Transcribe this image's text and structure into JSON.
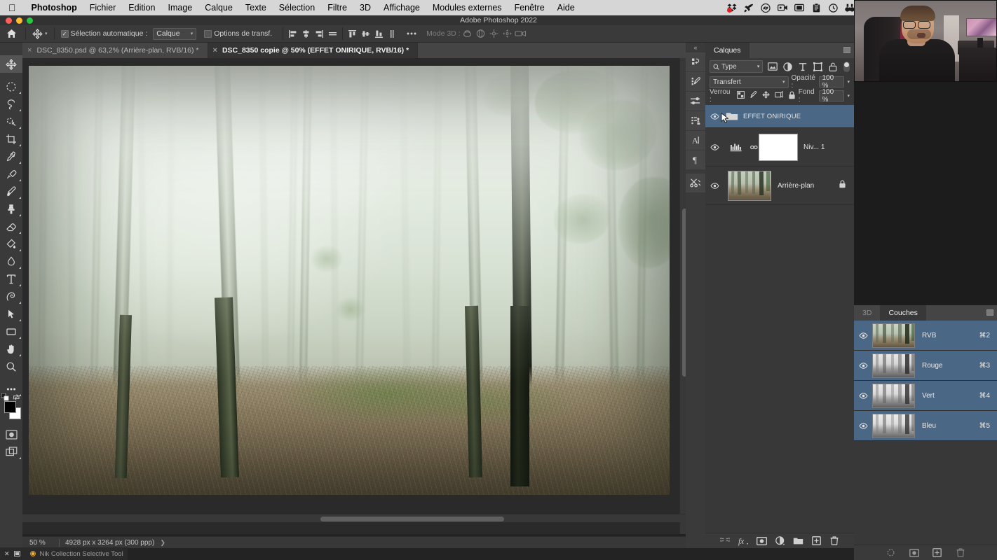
{
  "mac_menubar": {
    "apple": "apple-logo",
    "items": [
      {
        "label": "Photoshop",
        "bold": true
      },
      {
        "label": "Fichier"
      },
      {
        "label": "Edition"
      },
      {
        "label": "Image"
      },
      {
        "label": "Calque"
      },
      {
        "label": "Texte"
      },
      {
        "label": "Sélection"
      },
      {
        "label": "Filtre"
      },
      {
        "label": "3D"
      },
      {
        "label": "Affichage"
      },
      {
        "label": "Modules externes"
      },
      {
        "label": "Fenêtre"
      },
      {
        "label": "Aide"
      }
    ],
    "tray": [
      {
        "name": "dropbox-icon"
      },
      {
        "name": "vpn-rocket-icon"
      },
      {
        "name": "creative-cloud-icon"
      },
      {
        "name": "screen-record-icon"
      },
      {
        "name": "display-arrangement-icon"
      },
      {
        "name": "clipboard-icon"
      },
      {
        "name": "time-machine-icon"
      },
      {
        "name": "binoculars-icon"
      },
      {
        "name": "stats-icon"
      },
      {
        "name": "airplay-icon"
      },
      {
        "name": "volume-icon"
      },
      {
        "name": "record-icon"
      },
      {
        "name": "headphones-icon"
      },
      {
        "name": "belgium-flag-icon"
      },
      {
        "name": "bluetooth-icon"
      },
      {
        "name": "wifi-icon"
      }
    ]
  },
  "window": {
    "title": "Adobe Photoshop 2022",
    "traffic": {
      "close": "#ff5f57",
      "minimize": "#febc2e",
      "zoom": "#28c840"
    }
  },
  "options_bar": {
    "home_icon": "home-icon",
    "tool_icon": "move-tool-icon",
    "auto_select_label": "Sélection automatique :",
    "auto_select_checked": true,
    "target_value": "Calque",
    "transform_label": "Options de transf.",
    "transform_checked": false,
    "mode_3d_label": "Mode 3D :",
    "align_icons": [
      "align-left-icon",
      "align-center-h-icon",
      "align-right-icon",
      "distribute-h-icon"
    ],
    "align_icons_v": [
      "align-top-icon",
      "align-middle-icon",
      "align-bottom-icon",
      "distribute-v-icon"
    ],
    "more_icon": "more-options-icon",
    "mode3d_icons": [
      "rotate-3d-icon",
      "roll-3d-icon",
      "drag-3d-icon",
      "slide-3d-icon",
      "scale-3d-icon"
    ]
  },
  "document_tabs": [
    {
      "label": "DSC_8350.psd @ 63,2% (Arrière-plan, RVB/16) *",
      "active": false,
      "close": "×"
    },
    {
      "label": "DSC_8350 copie @ 50% (EFFET ONIRIQUE, RVB/16) *",
      "active": true,
      "close": "×"
    }
  ],
  "left_toolbar": {
    "tools": [
      {
        "name": "move-tool",
        "selected": true,
        "has_corner": false
      },
      {
        "name": "elliptical-marquee-tool",
        "selected": false,
        "has_corner": true
      },
      {
        "name": "lasso-tool",
        "selected": false,
        "has_corner": true
      },
      {
        "name": "object-selection-tool",
        "selected": false,
        "has_corner": true
      },
      {
        "name": "crop-tool",
        "selected": false,
        "has_corner": true
      },
      {
        "name": "eyedropper-tool",
        "selected": false,
        "has_corner": true
      },
      {
        "name": "healing-brush-tool",
        "selected": false,
        "has_corner": true
      },
      {
        "name": "brush-tool",
        "selected": false,
        "has_corner": true
      },
      {
        "name": "clone-stamp-tool",
        "selected": false,
        "has_corner": true
      },
      {
        "name": "eraser-tool",
        "selected": false,
        "has_corner": true
      },
      {
        "name": "gradient-tool",
        "selected": false,
        "has_corner": true
      },
      {
        "name": "blur-tool",
        "selected": false,
        "has_corner": true
      },
      {
        "name": "type-tool",
        "selected": false,
        "has_corner": true
      },
      {
        "name": "pen-tool",
        "selected": false,
        "has_corner": true
      },
      {
        "name": "path-selection-tool",
        "selected": false,
        "has_corner": true
      },
      {
        "name": "rectangle-tool",
        "selected": false,
        "has_corner": true
      },
      {
        "name": "hand-tool",
        "selected": false,
        "has_corner": true
      },
      {
        "name": "zoom-tool",
        "selected": false,
        "has_corner": false
      },
      {
        "name": "edit-toolbar-tool",
        "selected": false,
        "has_corner": true
      }
    ],
    "foreground_color": "#000000",
    "background_color": "#ffffff",
    "quick_mask_icon": "quick-mask-icon",
    "screen_mode_icon": "screen-mode-icon"
  },
  "canvas": {
    "image_alt": "forest-photograph",
    "status": {
      "zoom": "50 %",
      "dimensions": "4928 px x 3264 px (300 ppp)",
      "arrow": "❯"
    }
  },
  "icon_rail": {
    "collapse": "«",
    "buttons": [
      {
        "name": "history-panel-icon"
      },
      {
        "name": "brush-settings-icon"
      },
      {
        "name": "adjustments-icon"
      },
      {
        "name": "actions-panel-icon"
      },
      {
        "name": "character-panel-icon"
      },
      {
        "name": "paragraph-panel-icon"
      },
      {
        "name": "tools-preset-icon"
      }
    ]
  },
  "layers_panel": {
    "tab_label": "Calques",
    "menu_icon": "panel-menu-icon",
    "filter": {
      "search_icon": "search-icon",
      "value": "Type",
      "chevron": "⌄",
      "kind_icons": [
        {
          "name": "filter-pixel-icon"
        },
        {
          "name": "filter-adjustment-icon"
        },
        {
          "name": "filter-type-icon"
        },
        {
          "name": "filter-shape-icon"
        },
        {
          "name": "filter-smart-object-icon"
        }
      ],
      "toggle_name": "filter-enable-toggle"
    },
    "blend_mode": "Transfert",
    "opacity_label": "Opacité :",
    "opacity_value": "100 %",
    "lock_label": "Verrou :",
    "fill_label": "Fond :",
    "fill_value": "100 %",
    "lock_icons": [
      {
        "name": "lock-transparent-pixels-icon"
      },
      {
        "name": "lock-image-pixels-icon"
      },
      {
        "name": "lock-position-icon"
      },
      {
        "name": "lock-artboard-nesting-icon"
      },
      {
        "name": "lock-all-icon"
      }
    ],
    "layers": [
      {
        "name": "EFFET ONIRIQUE",
        "type": "group",
        "selected": true,
        "visible": true,
        "has_cursor": true
      },
      {
        "name": "Niv... 1",
        "type": "adjustment-levels",
        "selected": false,
        "visible": true,
        "linked": true,
        "mask": "white"
      },
      {
        "name": "Arrière-plan",
        "type": "image",
        "selected": false,
        "visible": true,
        "locked": true
      }
    ],
    "bottom_icons": [
      {
        "name": "link-layers-icon"
      },
      {
        "name": "layer-style-fx-icon"
      },
      {
        "name": "add-layer-mask-icon"
      },
      {
        "name": "new-adjustment-layer-icon"
      },
      {
        "name": "new-group-icon"
      },
      {
        "name": "new-layer-icon"
      },
      {
        "name": "delete-layer-icon"
      }
    ]
  },
  "channels_panel": {
    "tabs": [
      {
        "label": "3D",
        "active": false
      },
      {
        "label": "Couches",
        "active": true
      }
    ],
    "menu_icon": "panel-menu-icon",
    "channels": [
      {
        "name": "RVB",
        "shortcut": "⌘2",
        "visible": true,
        "color": true
      },
      {
        "name": "Rouge",
        "shortcut": "⌘3",
        "visible": true,
        "color": false
      },
      {
        "name": "Vert",
        "shortcut": "⌘4",
        "visible": true,
        "color": false
      },
      {
        "name": "Bleu",
        "shortcut": "⌘5",
        "visible": true,
        "color": false
      }
    ],
    "bottom_icons": [
      {
        "name": "load-channel-as-selection-icon"
      },
      {
        "name": "save-selection-as-channel-icon"
      },
      {
        "name": "new-channel-icon"
      },
      {
        "name": "delete-channel-icon"
      }
    ]
  },
  "status_overlay": {
    "nik_label": "Nik Collection Selective Tool",
    "nik_icon": "nik-collection-icon",
    "left_icons": [
      "close-icon",
      "minimize-icon"
    ]
  },
  "colors": {
    "panel_bg": "#383838",
    "toolbar_bg": "#3a3a3a",
    "selection_blue": "#4a6885",
    "text": "#d0d0d0"
  }
}
